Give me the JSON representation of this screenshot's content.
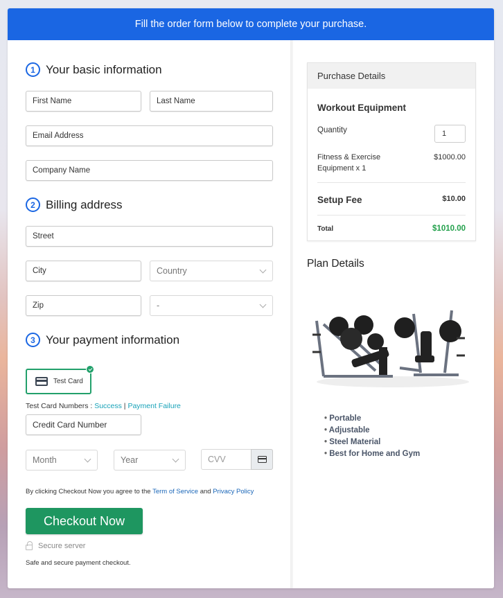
{
  "banner": {
    "text": "Fill the order form below to complete your purchase."
  },
  "sections": {
    "basic": {
      "number": "1",
      "title": "Your basic information"
    },
    "billing": {
      "number": "2",
      "title": "Billing address"
    },
    "payment": {
      "number": "3",
      "title": "Your payment information"
    }
  },
  "fields": {
    "first_name": "First Name",
    "last_name": "Last Name",
    "email": "Email Address",
    "company": "Company Name",
    "street": "Street",
    "city": "City",
    "country": "Country",
    "zip": "Zip",
    "state": "-",
    "card_number": "Credit Card Number",
    "month": "Month",
    "year": "Year",
    "cvv": "CVV"
  },
  "payment": {
    "card_option_label": "Test Card",
    "test_numbers_label": "Test Card Numbers : ",
    "success_link": "Success",
    "separator": " | ",
    "failure_link": "Payment Failure"
  },
  "terms": {
    "prefix": "By clicking Checkout Now you agree to the ",
    "tos_link": "Term of Service",
    "and": " and ",
    "privacy_link": "Privacy Policy"
  },
  "checkout_button": "Checkout Now",
  "secure_server": "Secure server",
  "safe_text": "Safe and secure payment checkout.",
  "purchase": {
    "heading": "Purchase Details",
    "product": "Workout Equipment",
    "quantity_label": "Quantity",
    "quantity_value": "1",
    "item_name": "Fitness & Exercise Equipment x 1",
    "item_price": "$1000.00",
    "setup_label": "Setup Fee",
    "setup_price": "$10.00",
    "total_label": "Total",
    "total_price": "$1010.00"
  },
  "plan": {
    "title": "Plan Details",
    "features": [
      "Portable",
      "Adjustable",
      "Steel Material",
      "Best for Home and Gym"
    ]
  }
}
